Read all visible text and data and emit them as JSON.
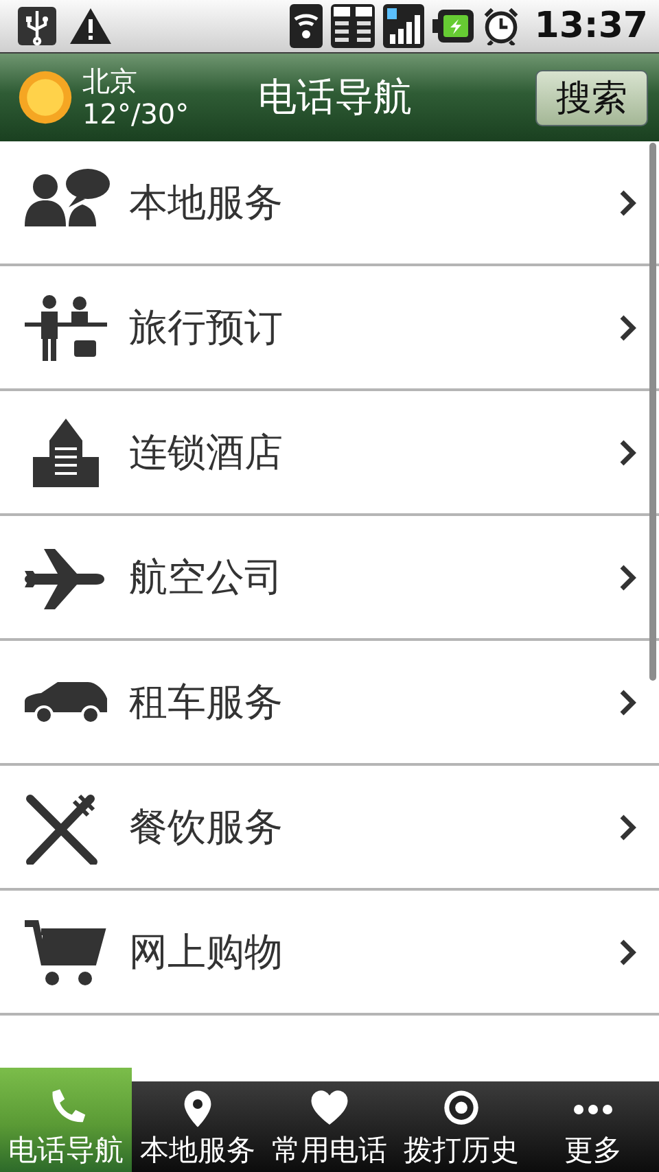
{
  "status_bar": {
    "time": "13:37"
  },
  "header": {
    "city": "北京",
    "temperature": "12°/30°",
    "title": "电话导航",
    "search_button": "搜索"
  },
  "list": [
    {
      "kind": "people",
      "label": "本地服务"
    },
    {
      "kind": "travel",
      "label": "旅行预订"
    },
    {
      "kind": "building",
      "label": "连锁酒店"
    },
    {
      "kind": "plane",
      "label": "航空公司"
    },
    {
      "kind": "car",
      "label": "租车服务"
    },
    {
      "kind": "dining",
      "label": "餐饮服务"
    },
    {
      "kind": "cart",
      "label": "网上购物"
    }
  ],
  "tabs": [
    {
      "kind": "phone",
      "label": "电话导航",
      "selected": true
    },
    {
      "kind": "pin",
      "label": "本地服务",
      "selected": false
    },
    {
      "kind": "heart",
      "label": "常用电话",
      "selected": false
    },
    {
      "kind": "dial",
      "label": "拨打历史",
      "selected": false
    },
    {
      "kind": "more",
      "label": "更多",
      "selected": false
    }
  ]
}
